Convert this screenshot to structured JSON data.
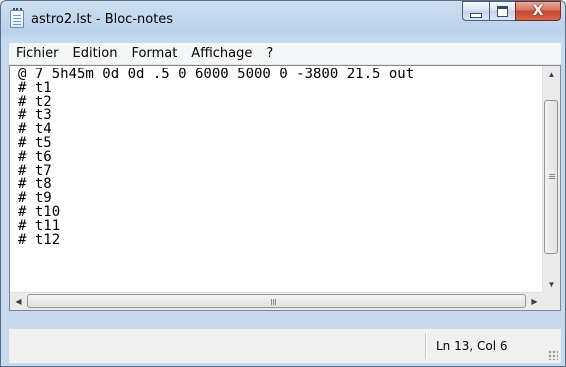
{
  "window": {
    "title": "astro2.lst - Bloc-notes",
    "icon": "notepad-icon"
  },
  "caption_buttons": {
    "minimize": "minimize-icon",
    "maximize": "maximize-icon",
    "close": "close-icon",
    "close_glyph": "X"
  },
  "menu": {
    "items": [
      "Fichier",
      "Edition",
      "Format",
      "Affichage",
      "?"
    ]
  },
  "editor": {
    "lines": [
      "@ 7 5h45m 0d 0d .5 0 6000 5000 0 -3800 21.5 out",
      "# t1",
      "# t2",
      "# t3",
      "# t4",
      "# t5",
      "# t6",
      "# t7",
      "# t8",
      "# t9",
      "# t10",
      "# t11",
      "# t12"
    ]
  },
  "status": {
    "position": "Ln 13, Col 6"
  },
  "colors": {
    "frame": "#c6d9ee",
    "close_button": "#c44a32",
    "status_bar": "#f0f0f0"
  }
}
